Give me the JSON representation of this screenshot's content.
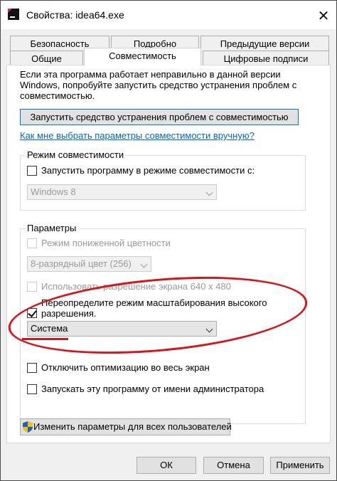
{
  "window": {
    "title": "Свойства: idea64.exe"
  },
  "tabs": {
    "row1": [
      "Безопасность",
      "Подробно",
      "Предыдущие версии"
    ],
    "row2": [
      "Общие",
      "Совместимость",
      "Цифровые подписи"
    ]
  },
  "compat": {
    "description": "Если эта программа работает неправильно в данной версии Windows, попробуйте запустить средство устранения проблем с совместимостью.",
    "troubleshooter_button": "Запустить средство устранения проблем с совместимостью",
    "manual_link": "Как мне выбрать параметры совместимости вручную?",
    "mode_group": {
      "title": "Режим совместимости",
      "checkbox_label": "Запустить программу в режиме совместимости с:",
      "checked": false,
      "os_select": "Windows 8"
    },
    "params_group": {
      "title": "Параметры",
      "reduced_color": {
        "label": "Режим пониженной цветности",
        "checked": false
      },
      "color_select": "8-разрядный цвет (256)",
      "res_640": {
        "label": "Использовать разрешение экрана 640 x 480",
        "checked": false
      },
      "high_dpi": {
        "label_line1": "Переопределите режим масштабирования высокого",
        "label_line2": "разрешения.",
        "checked": true
      },
      "dpi_select": "Система",
      "fullscreen_opt": {
        "label": "Отключить оптимизацию во весь экран",
        "checked": false
      },
      "run_admin": {
        "label": "Запускать эту программу от имени администратора",
        "checked": false
      }
    },
    "all_users_button": "Изменить параметры для всех пользователей"
  },
  "footer": {
    "ok": "ОК",
    "cancel": "Отмена",
    "apply": "Применить"
  },
  "colors": {
    "accent": "#0078d7",
    "link": "#0066cc",
    "annotation": "#d8141a"
  }
}
